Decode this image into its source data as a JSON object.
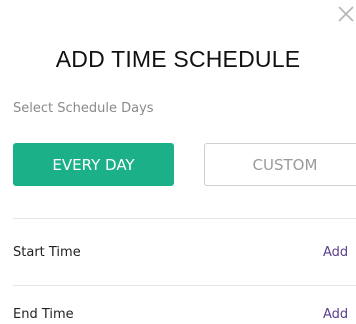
{
  "modal": {
    "title": "ADD TIME SCHEDULE",
    "subtitle": "Select Schedule Days",
    "close_icon": "close-icon"
  },
  "schedule_days": {
    "options": [
      {
        "label": "EVERY DAY",
        "selected": true
      },
      {
        "label": "CUSTOM",
        "selected": false
      }
    ]
  },
  "rows": [
    {
      "label": "Start Time",
      "action": "Add"
    },
    {
      "label": "End Time",
      "action": "Add"
    }
  ],
  "colors": {
    "accent": "#1cb089",
    "link": "#5a3e8c"
  }
}
